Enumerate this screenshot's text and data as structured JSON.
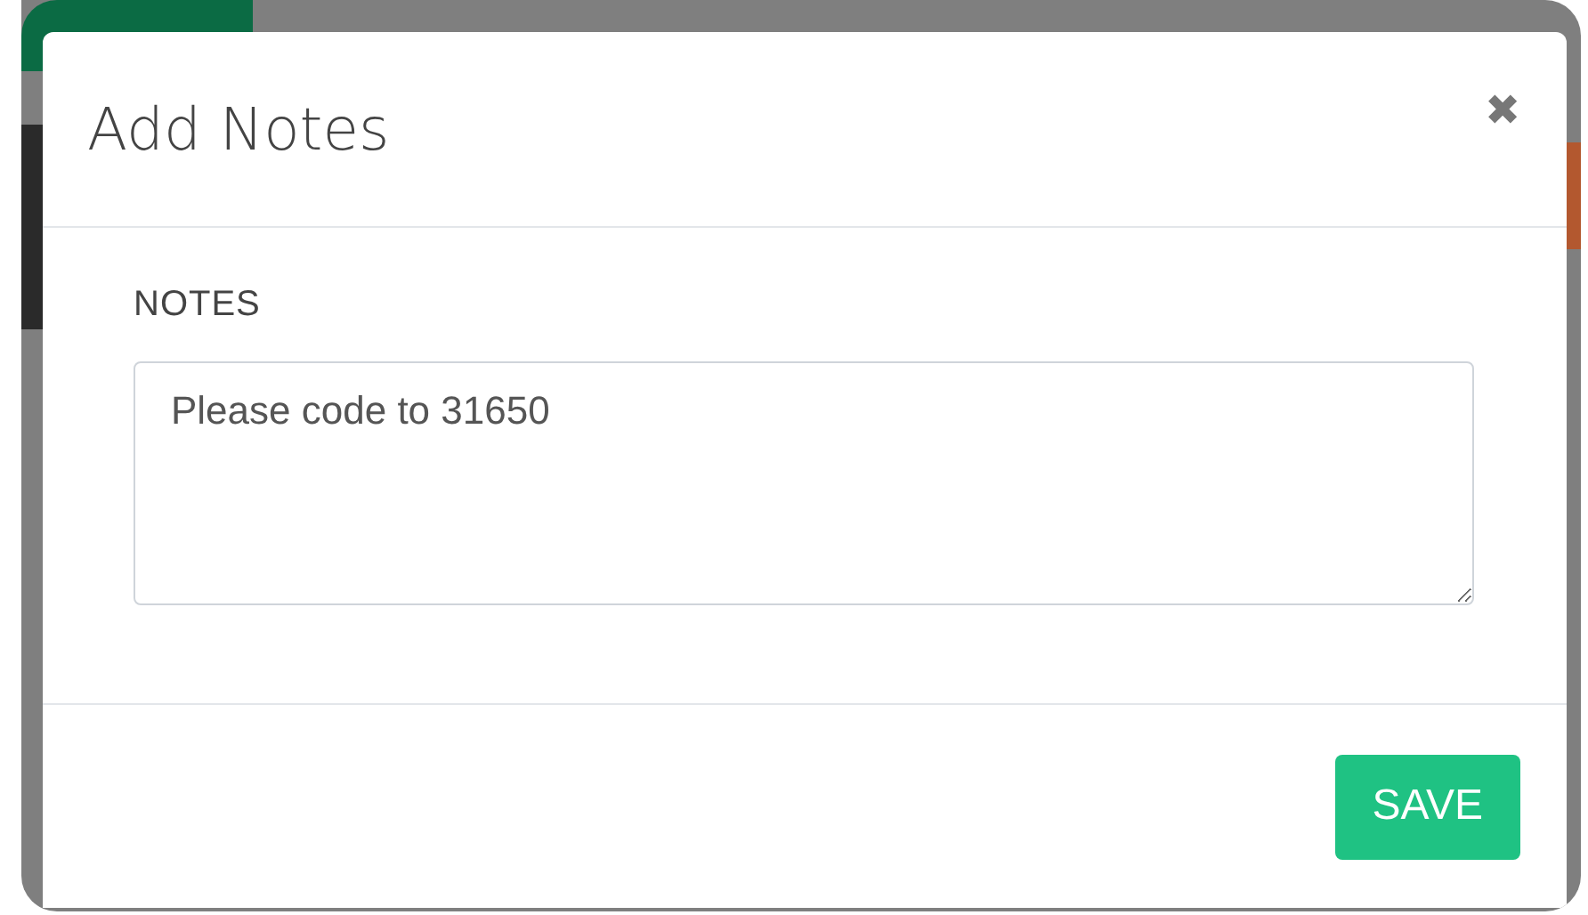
{
  "dialog": {
    "title": "Add Notes",
    "close": "✖"
  },
  "notes": {
    "label": "NOTES",
    "value": "Please code to 31650"
  },
  "buttons": [
    {
      "label": "SAVE",
      "kind": "primary"
    }
  ]
}
